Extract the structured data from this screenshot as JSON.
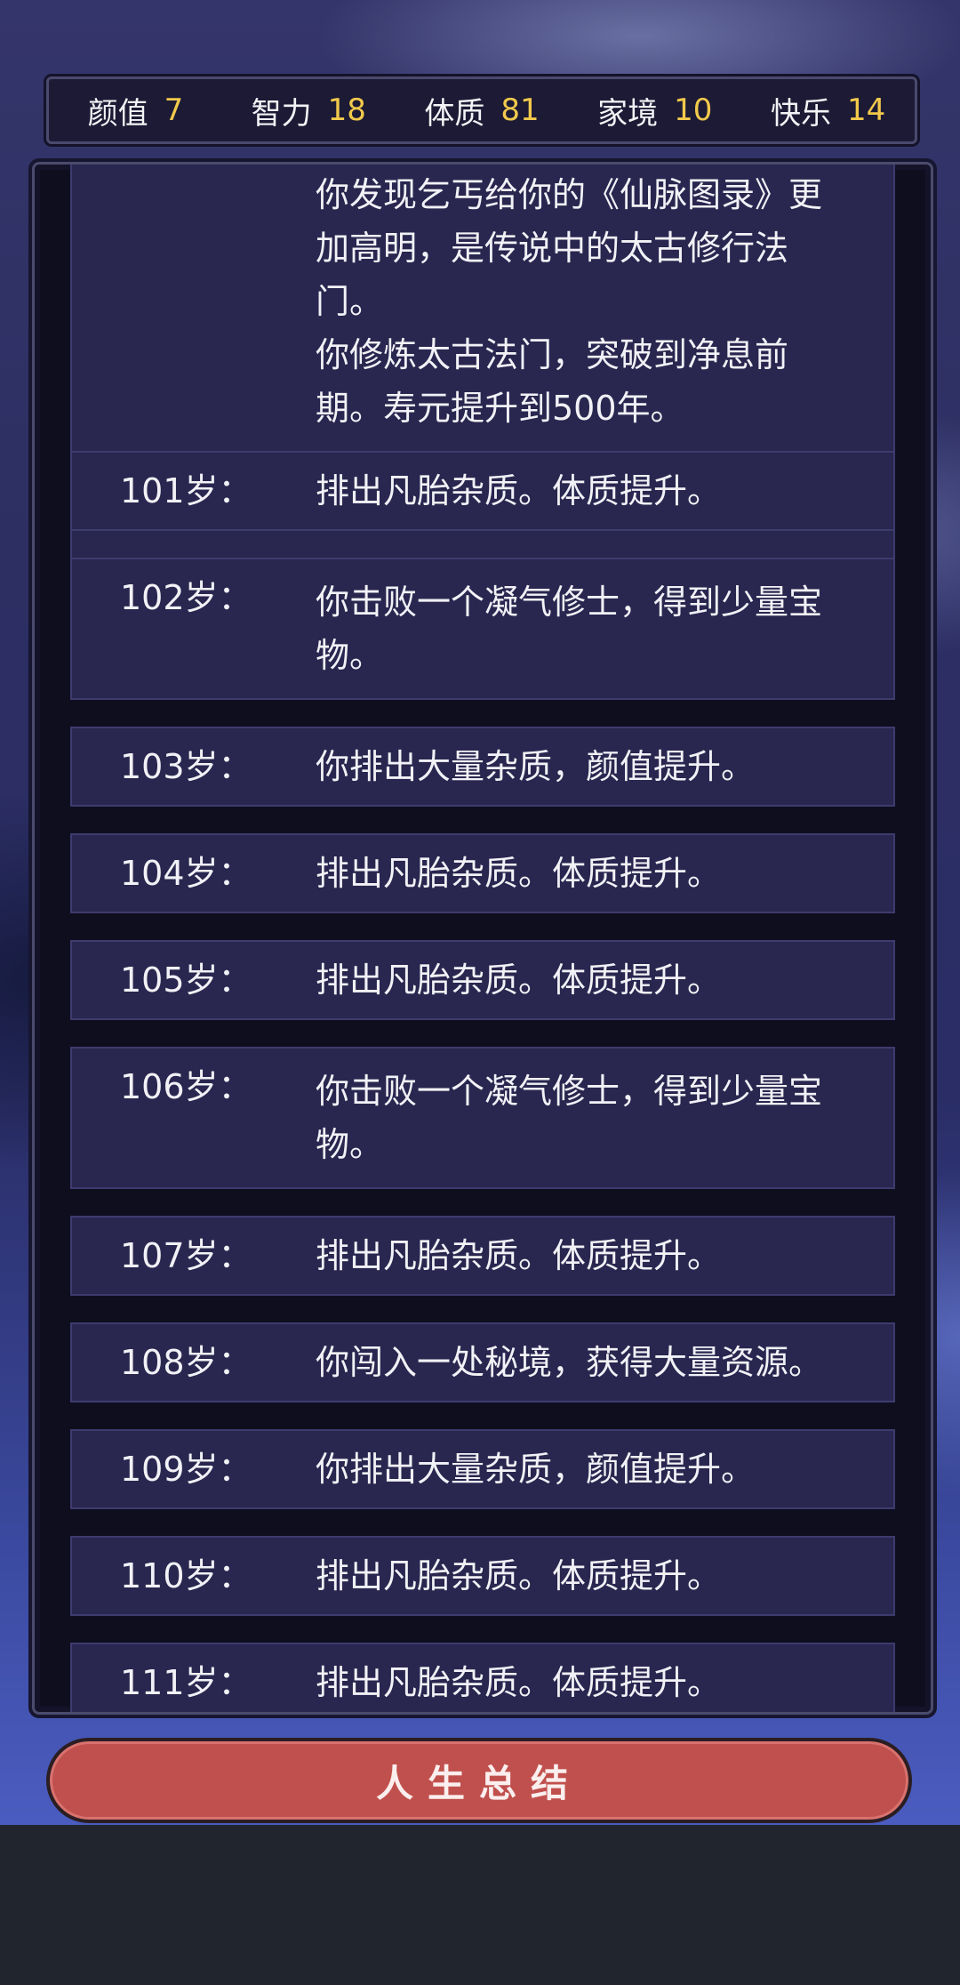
{
  "stats": [
    {
      "label": "颜值",
      "value": "7"
    },
    {
      "label": "智力",
      "value": "18"
    },
    {
      "label": "体质",
      "value": "81"
    },
    {
      "label": "家境",
      "value": "10"
    },
    {
      "label": "快乐",
      "value": "14"
    }
  ],
  "top_entry": {
    "lines": [
      "你发现乞丐给你的《仙脉图录》更",
      "加高明，是传说中的太古修行法",
      "门。",
      "你修炼太古法门，突破到净息前",
      "期。寿元提升到500年。"
    ]
  },
  "entries": [
    {
      "age": "101岁：",
      "text": "排出凡胎杂质。体质提升。"
    },
    {
      "age": "102岁：",
      "text": "你击败一个凝气修士，得到少量宝物。"
    },
    {
      "age": "103岁：",
      "text": "你排出大量杂质，颜值提升。"
    },
    {
      "age": "104岁：",
      "text": "排出凡胎杂质。体质提升。"
    },
    {
      "age": "105岁：",
      "text": "排出凡胎杂质。体质提升。"
    },
    {
      "age": "106岁：",
      "text": "你击败一个凝气修士，得到少量宝物。"
    },
    {
      "age": "107岁：",
      "text": "排出凡胎杂质。体质提升。"
    },
    {
      "age": "108岁：",
      "text": "你闯入一处秘境，获得大量资源。"
    },
    {
      "age": "109岁：",
      "text": "你排出大量杂质，颜值提升。"
    },
    {
      "age": "110岁：",
      "text": "排出凡胎杂质。体质提升。"
    },
    {
      "age": "111岁：",
      "text": "排出凡胎杂质。体质提升。"
    }
  ],
  "summary_button": {
    "label": "人生总结"
  }
}
